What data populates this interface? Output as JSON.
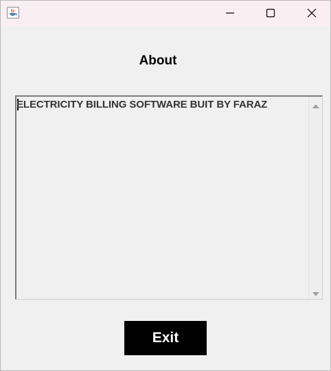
{
  "window": {
    "title": "",
    "controls": {
      "minimize": "minimize-icon",
      "maximize": "maximize-icon",
      "close": "close-icon"
    },
    "titlebar_color": "#f9eef2",
    "background_color": "#f0f0f0"
  },
  "main": {
    "heading": "About",
    "text_area": {
      "content": "ELECTRICITY BILLING SOFTWARE BUIT BY FARAZ"
    },
    "exit_button": {
      "label": "Exit",
      "background": "#000000",
      "color": "#ffffff"
    }
  }
}
